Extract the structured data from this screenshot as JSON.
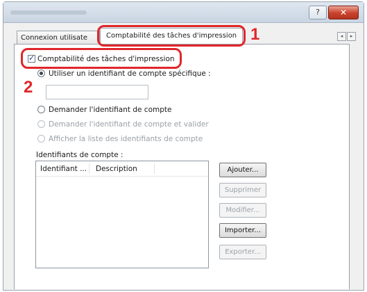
{
  "window": {
    "help_label": "?",
    "close_label": "✕"
  },
  "tabs": [
    {
      "label": "Connexion utilisate"
    },
    {
      "label": "Comptabilité des tâches d'impression"
    }
  ],
  "tab_scroll": {
    "left": "◂",
    "right": "▸"
  },
  "job_accounting": {
    "checkbox_label": "Comptabilité des tâches d'impression",
    "checked": true,
    "options": [
      {
        "label": "Utiliser un identifiant de compte spécifique :",
        "selected": true,
        "enabled": true
      },
      {
        "label": "Demander l'identifiant de compte",
        "selected": false,
        "enabled": true
      },
      {
        "label": "Demander l'identifiant de compte et valider",
        "selected": false,
        "enabled": false
      },
      {
        "label": "Afficher la liste des identifiants de compte",
        "selected": false,
        "enabled": false
      }
    ],
    "account_id_value": ""
  },
  "account_list": {
    "label": "Identifiants de compte :",
    "columns": [
      "Identifiant ...",
      "Description"
    ],
    "rows": []
  },
  "buttons": {
    "add": "Ajouter...",
    "delete": "Supprimer",
    "edit": "Modifier...",
    "import": "Importer...",
    "export": "Exporter..."
  },
  "callouts": {
    "one": "1",
    "two": "2"
  },
  "colors": {
    "callout": "#e0262a",
    "close_button": "#c8422c"
  }
}
